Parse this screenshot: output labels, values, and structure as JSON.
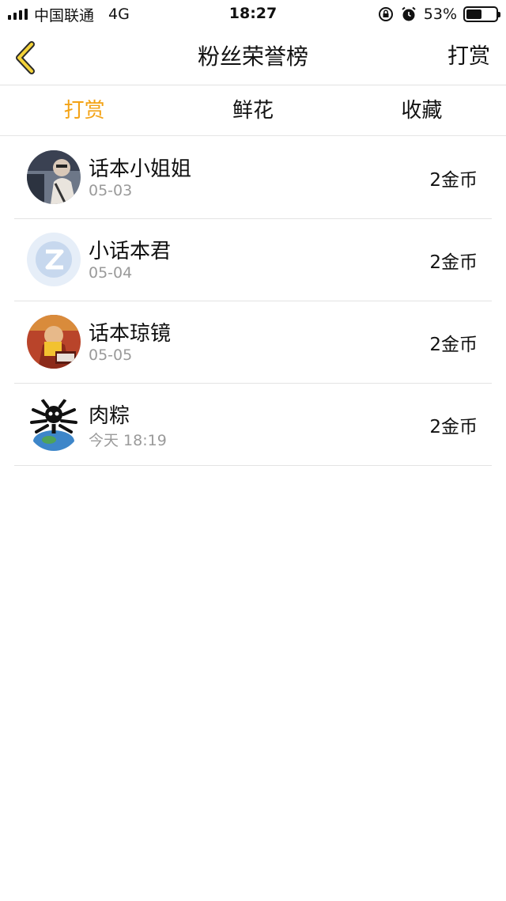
{
  "status_bar": {
    "carrier": "中国联通",
    "network": "4G",
    "time": "18:27",
    "battery": "53%",
    "battery_level": 0.53
  },
  "nav": {
    "title": "粉丝荣誉榜",
    "action": "打赏",
    "back_icon": "chevron-left-icon",
    "accent": "#f3a316"
  },
  "tabs": [
    {
      "label": "打赏",
      "active": true
    },
    {
      "label": "鲜花",
      "active": false
    },
    {
      "label": "收藏",
      "active": false
    }
  ],
  "fans": [
    {
      "name": "话本小姐姐",
      "date": "05-03",
      "amount": "2金币"
    },
    {
      "name": "小话本君",
      "date": "05-04",
      "amount": "2金币"
    },
    {
      "name": "话本琼镜",
      "date": "05-05",
      "amount": "2金币"
    },
    {
      "name": "肉粽",
      "date": "今天 18:19",
      "amount": "2金币"
    }
  ]
}
